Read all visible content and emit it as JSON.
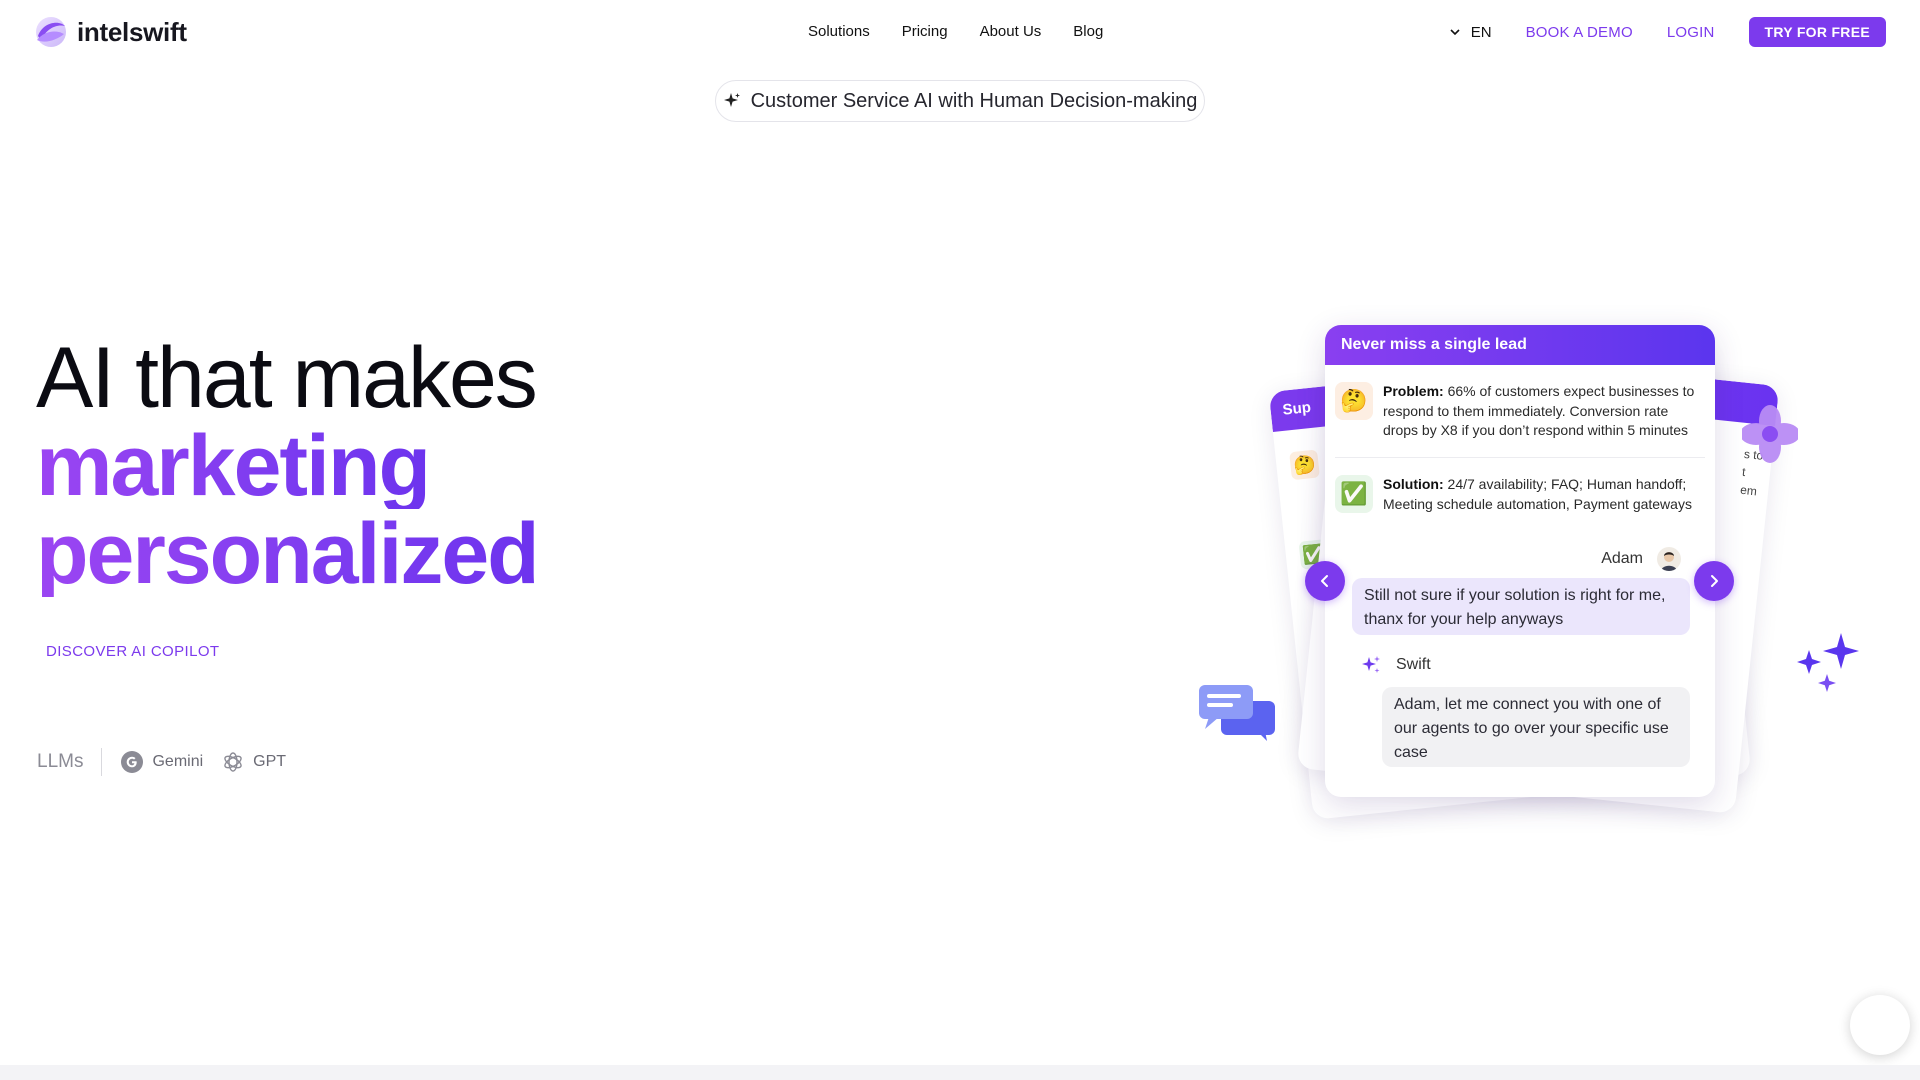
{
  "brand": {
    "name": "intelswift",
    "accent": "#7c3aed"
  },
  "nav": {
    "links": [
      "Solutions",
      "Pricing",
      "About Us",
      "Blog"
    ],
    "language": "EN",
    "book_demo": "BOOK A DEMO",
    "login": "LOGIN",
    "try_free": "TRY FOR FREE"
  },
  "badge": {
    "icon": "sparkle-icon",
    "text": "Customer Service AI with Human Decision-making"
  },
  "hero": {
    "line1": "AI that makes",
    "line2": "marketing",
    "line3": "personalized",
    "discover": "DISCOVER AI COPILOT"
  },
  "llms": {
    "label": "LLMs",
    "items": [
      {
        "name": "Gemini",
        "icon": "google-g-icon"
      },
      {
        "name": "GPT",
        "icon": "openai-icon"
      }
    ]
  },
  "card": {
    "title": "Never miss a single lead",
    "problem_label": "Problem:",
    "problem_text": " 66% of customers expect businesses to respond to them immediately. Conversion rate drops by X8 if you don’t respond within 5 minutes",
    "problem_emoji": "🤔",
    "solution_label": "Solution:",
    "solution_text": " 24/7 availability; FAQ; Human handoff; Meeting schedule automation, Payment gateways",
    "solution_emoji": "✅",
    "user_name": "Adam",
    "user_message": "Still not sure if your solution is right for me, thanx for your help anyways",
    "bot_name": "Swift",
    "bot_message": "Adam, let me connect you with one of our agents to go over your specific use case"
  },
  "back_cards": {
    "left_title": "Sup",
    "left_emoji_1": "🤔",
    "left_emoji_2": "✅",
    "right_text_1": "s to",
    "right_text_2": "t",
    "right_text_3": "em"
  }
}
